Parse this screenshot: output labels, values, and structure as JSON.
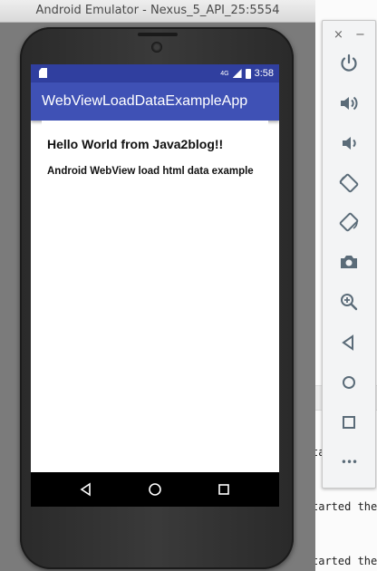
{
  "window": {
    "title": "Android Emulator - Nexus_5_API_25:5554"
  },
  "status_bar": {
    "network": "4G",
    "time": "3:58"
  },
  "app": {
    "title": "WebViewLoadDataExampleApp",
    "heading": "Hello World from Java2blog!!",
    "subheading": "Android WebView load html data example"
  },
  "ide": {
    "line1": "ta",
    "line2": "tarted the",
    "line3": "tarted the"
  },
  "toolbar": {
    "close": "×",
    "minimize": "−",
    "more": "•••",
    "items": [
      "power",
      "volume-up",
      "volume-down",
      "rotate-left",
      "rotate-right",
      "screenshot",
      "zoom",
      "back",
      "home",
      "overview"
    ]
  },
  "colors": {
    "status_bar": "#303f9f",
    "app_bar": "#3f51b5",
    "toolbar_icon": "#5a6b78"
  }
}
